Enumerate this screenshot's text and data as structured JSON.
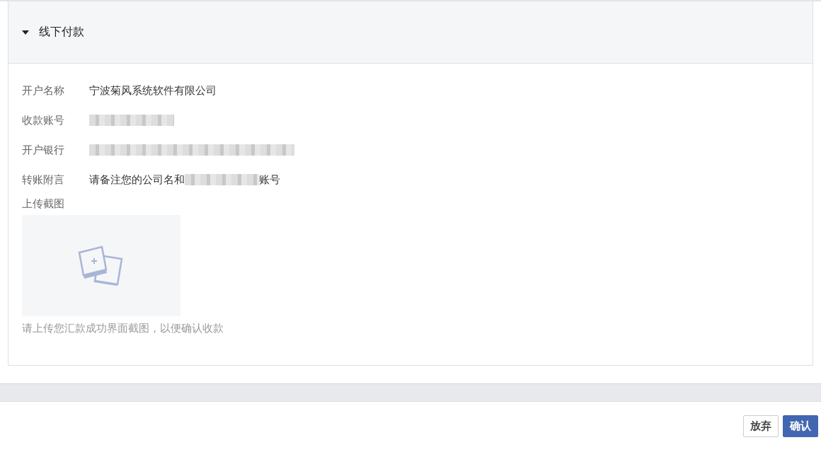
{
  "section": {
    "title": "线下付款",
    "expanded": true
  },
  "fields": [
    {
      "label": "开户名称",
      "value": "宁波菊风系统软件有限公司",
      "redacted": false
    },
    {
      "label": "收款账号",
      "redacted": true
    },
    {
      "label": "开户银行",
      "redacted": true
    },
    {
      "label": "转账附言",
      "value": "请备注您的公司名和",
      "redacted": true,
      "suffix": "账号"
    }
  ],
  "upload": {
    "label": "上传截图",
    "hint": "请上传您汇款成功界面截图，以便确认收款"
  },
  "buttons": [
    {
      "label": "放弃",
      "kind": "secondary"
    },
    {
      "label": "确认",
      "kind": "primary"
    }
  ]
}
